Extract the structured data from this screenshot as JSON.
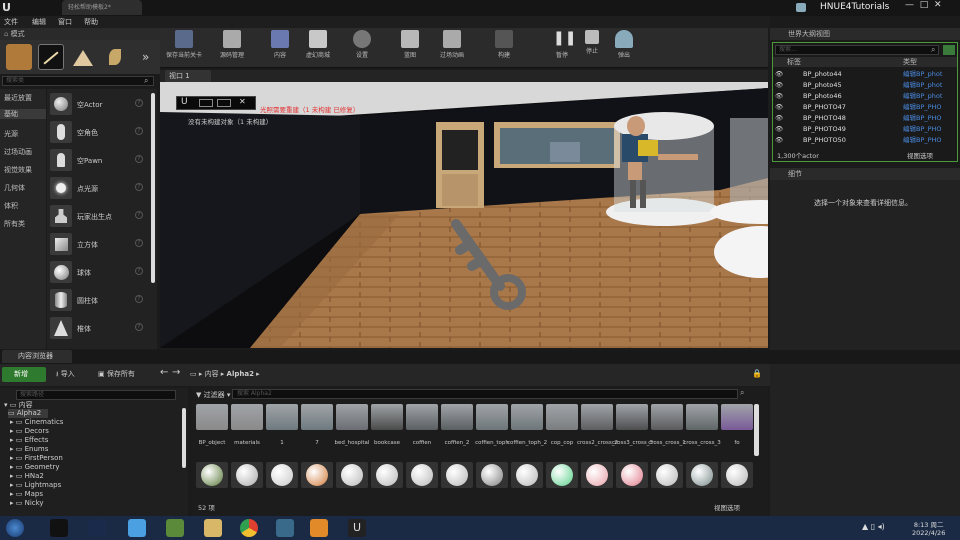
{
  "window": {
    "doc_tab": "轻松帮助模板2*",
    "brand": "HNUE4Tutorials"
  },
  "menu": [
    "文件",
    "编辑",
    "窗口",
    "帮助"
  ],
  "modes": {
    "title": "模式",
    "search_placeholder": "搜索类",
    "categories": [
      "最近放置",
      "基础",
      "光源",
      "过场动画",
      "视觉效果",
      "几何体",
      "体积",
      "所有类"
    ],
    "items": [
      "空Actor",
      "空角色",
      "空Pawn",
      "点光源",
      "玩家出生点",
      "立方体",
      "球体",
      "圆柱体",
      "椎体"
    ]
  },
  "toolbar": [
    "保存当前关卡",
    "源码管理",
    "内容",
    "虚幻商城",
    "设置",
    "蓝图",
    "过场动画",
    "构建",
    "暂停",
    "停止",
    "弹出"
  ],
  "viewport": {
    "tab": "视口 1",
    "warning": "光照需要重建（1 未构建 已修复）",
    "subtext": "没有未构建对象（1 未构建）",
    "close_x": "✕"
  },
  "outliner": {
    "title": "世界大纲视图",
    "search_placeholder": "搜索...",
    "col_label": "标签",
    "col_type": "类型",
    "rows": [
      {
        "label": "BP_photo44",
        "type": "编辑BP_phot"
      },
      {
        "label": "BP_photo45",
        "type": "编辑BP_phot"
      },
      {
        "label": "BP_photo46",
        "type": "编辑BP_phot"
      },
      {
        "label": "BP_PHOTO47",
        "type": "编辑BP_PHO"
      },
      {
        "label": "BP_PHOTO48",
        "type": "编辑BP_PHO"
      },
      {
        "label": "BP_PHOTO49",
        "type": "编辑BP_PHO"
      },
      {
        "label": "BP_PHOTO50",
        "type": "编辑BP_PHO"
      }
    ],
    "count": "1,300个actor",
    "view_options": "视图选项"
  },
  "details": {
    "title": "细节",
    "empty": "选择一个对象来查看详细信息。"
  },
  "content_browser": {
    "tab": "内容浏览器",
    "new": "新增",
    "import": "导入",
    "save_all": "保存所有",
    "breadcrumb": [
      "内容",
      "Alpha2"
    ],
    "filter": "过滤器",
    "search_placeholder": "搜索 Alpha2",
    "folder_search_placeholder": "搜索路径",
    "folders": [
      "内容",
      "Alpha2",
      "Cinematics",
      "Decors",
      "Effects",
      "Enums",
      "FirstPerson",
      "Geometry",
      "HNa2",
      "Lightmaps",
      "Maps",
      "Nicky"
    ],
    "row1": [
      {
        "label": "BP_object",
        "color": "#8a8a8a"
      },
      {
        "label": "materials",
        "color": "#8a8a8a"
      },
      {
        "label": "1",
        "color": "#6e7a80"
      },
      {
        "label": "7",
        "color": "#6e7a80"
      },
      {
        "label": "bed_hospital",
        "color": "#6a6e72"
      },
      {
        "label": "bookcase",
        "color": "#4a4a4a"
      },
      {
        "label": "coffien",
        "color": "#5a5f62"
      },
      {
        "label": "coffien_2",
        "color": "#5a5f62"
      },
      {
        "label": "coffien_toph",
        "color": "#6e767a"
      },
      {
        "label": "coffien_toph_2",
        "color": "#6e767a"
      },
      {
        "label": "cop_cop",
        "color": "#7a7e80"
      },
      {
        "label": "cross2_cross_2",
        "color": "#5e5e60"
      },
      {
        "label": "cross3_cross_3",
        "color": "#4e4e50"
      },
      {
        "label": "cross_cross_1",
        "color": "#5a5a5c"
      },
      {
        "label": "cross_cross_3",
        "color": "#606668"
      },
      {
        "label": "fo",
        "color": "#7a5a9a"
      }
    ],
    "row2_colors": [
      "#5a7a3a",
      "#aaaaaa",
      "#c8c8c8",
      "#d07a3a",
      "#b8b8b8",
      "#b8b8b8",
      "#b8b8b8",
      "#b8b8b8",
      "#808080",
      "#b8b8b8",
      "#5ad08a",
      "#e8a0a8",
      "#e07a8a",
      "#b8b8b8",
      "#7a8a8a",
      "#b8b8b8"
    ],
    "item_count": "52 项",
    "view_options": "视图选项"
  },
  "taskbar": {
    "time": "8:13 周二",
    "date": "2022/4/26"
  }
}
